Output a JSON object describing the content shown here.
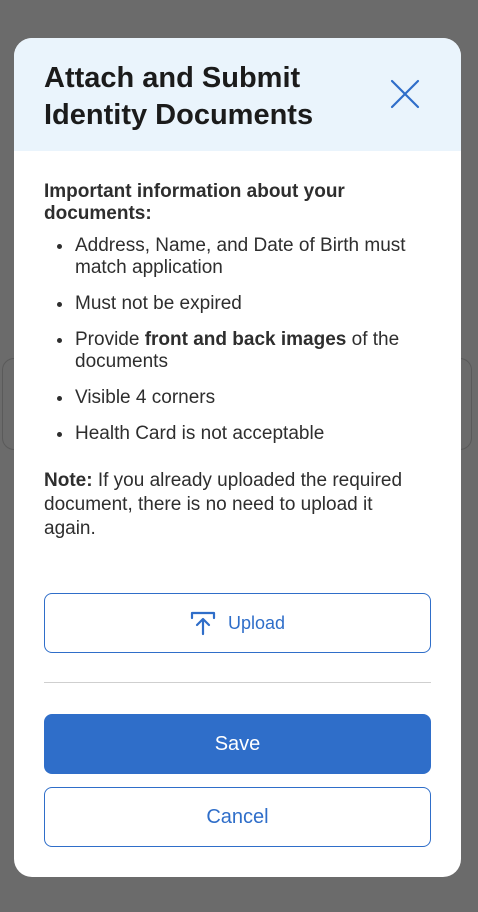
{
  "dialog": {
    "title": "Attach and Submit Identity Documents",
    "close_icon": "close-icon",
    "info_heading": "Important information about your documents:",
    "requirements": [
      {
        "text": "Address, Name, and Date of Birth must match application"
      },
      {
        "text": "Must not be expired"
      },
      {
        "prefix": "Provide ",
        "bold": "front and back images",
        "suffix": " of the documents"
      },
      {
        "text": "Visible 4 corners"
      },
      {
        "text": "Health Card is not acceptable"
      }
    ],
    "note_label": "Note:",
    "note_text": " If you already uploaded the required document, there is no need to upload it again.",
    "upload_label": "Upload",
    "upload_icon": "upload-icon",
    "save_label": "Save",
    "cancel_label": "Cancel"
  },
  "colors": {
    "accent": "#2f6ec9",
    "header_bg": "#eaf4fc",
    "backdrop": "#6b6b6b"
  }
}
